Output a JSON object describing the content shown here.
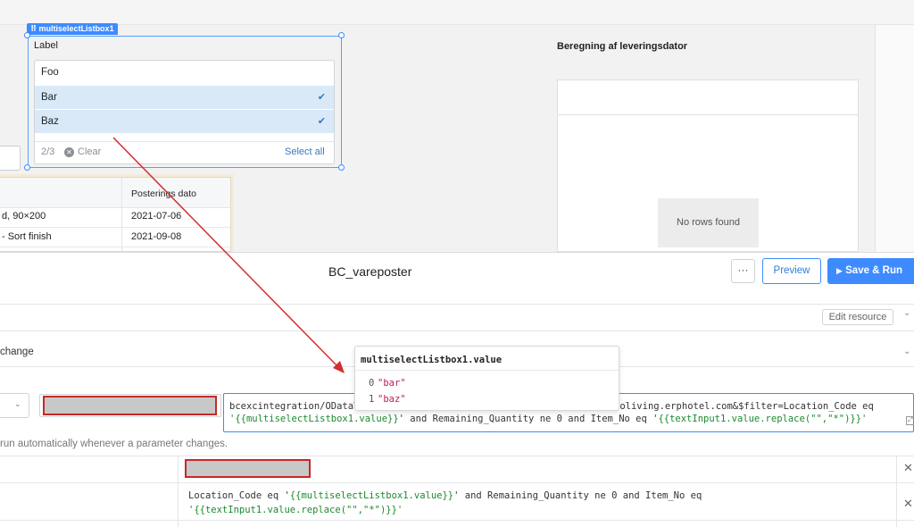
{
  "multiselect": {
    "tag": "multiselectListbox1",
    "label": "Label",
    "options": [
      {
        "label": "Foo",
        "selected": false
      },
      {
        "label": "Bar",
        "selected": true
      },
      {
        "label": "Baz",
        "selected": true
      }
    ],
    "check_glyph": "✔",
    "count": "2/3",
    "clear_label": "Clear",
    "select_all_label": "Select all"
  },
  "left_table": {
    "header": "Posterings dato",
    "rows": [
      {
        "name": "d, 90×200",
        "date": "2021-07-06"
      },
      {
        "name": " - Sort finish",
        "date": "2021-09-08"
      }
    ]
  },
  "calc": {
    "title": "Beregning af leveringsdator",
    "empty_text": "No rows found"
  },
  "editor": {
    "title": "BC_vareposter",
    "more_label": "···",
    "preview_label": "Preview",
    "save_run_label": "Save & Run",
    "save_run_icon": "▶",
    "edit_resource_label": "Edit resource",
    "change_label": "change",
    "url_line1_prefix": "bcexcintegration/ODataV",
    "url_line1_suffix": "ant=unoliving.erphotel.com&$filter=Location_Code eq",
    "url_line2_open": "'",
    "url_line2_expr1": "{{multiselectListbox1.value}}",
    "url_line2_mid": "' and Remaining_Quantity ne 0 and Item_No eq '",
    "url_line2_expr2": "{{textInput1.value.replace(\"\",\"*\")}}",
    "url_line2_close": "'",
    "auto_run_text": "run automatically whenever a parameter changes.",
    "filter_line1_prefix": "Location_Code eq '",
    "filter_line1_expr": "{{multiselectListbox1.value}}",
    "filter_line1_suffix": "' and Remaining_Quantity ne 0 and Item_No eq",
    "filter_line2_open": "'",
    "filter_line2_expr": "{{textInput1.value.replace(\"\",\"*\")}}",
    "filter_line2_close": "'",
    "close_glyph": "✕",
    "chevron_glyph": "⌄"
  },
  "tooltip": {
    "title": "multiselectListbox1.value",
    "items": [
      {
        "index": "0",
        "value": "\"bar\""
      },
      {
        "index": "1",
        "value": "\"baz\""
      }
    ]
  },
  "colors": {
    "accent": "#3d8bff",
    "selected_row": "#d9e9f8",
    "annotation_red": "#d32f2f",
    "template_green": "#1a8a2e",
    "string_pink": "#c2185b"
  }
}
